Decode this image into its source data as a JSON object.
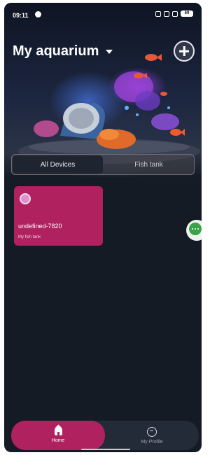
{
  "status_bar": {
    "time": "09:11",
    "battery": "69"
  },
  "header": {
    "title": "My aquarium"
  },
  "tabs": [
    {
      "label": "All Devices",
      "active": true
    },
    {
      "label": "Fish tank",
      "active": false
    }
  ],
  "devices": [
    {
      "name": "undefined-7820",
      "location": "My fish tank"
    }
  ],
  "bottom_nav": [
    {
      "label": "Home",
      "icon": "home-icon",
      "active": true
    },
    {
      "label": "My Profile",
      "icon": "profile-icon",
      "active": false
    }
  ],
  "colors": {
    "accent": "#b0215f",
    "background": "#151b25",
    "chat_button": "#3aa34a"
  }
}
